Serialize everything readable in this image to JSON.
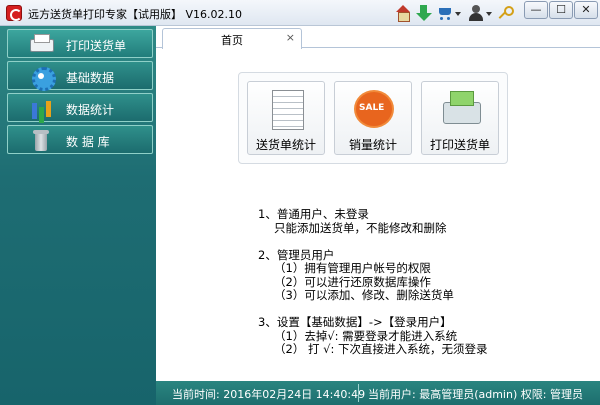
{
  "window": {
    "title": "远方送货单打印专家【试用版】 V16.02.10",
    "buttons": {
      "minimize": "—",
      "maximize": "☐",
      "close": "✕"
    }
  },
  "toolbar_icons": [
    "home-icon",
    "download-icon",
    "cart-icon",
    "user-icon",
    "key-icon"
  ],
  "sidebar": {
    "items": [
      {
        "label": "打印送货单",
        "icon": "printer-icon"
      },
      {
        "label": "基础数据",
        "icon": "gear-icon"
      },
      {
        "label": "数据统计",
        "icon": "bar-chart-icon"
      },
      {
        "label": "数 据 库",
        "icon": "trash-icon"
      }
    ]
  },
  "tabs": [
    {
      "label": "首页",
      "close": "×"
    }
  ],
  "tiles": [
    {
      "label": "送货单统计",
      "icon": "document-icon"
    },
    {
      "label": "销量统计",
      "icon": "sale-icon",
      "badge": "SALE"
    },
    {
      "label": "打印送货单",
      "icon": "printer-icon"
    }
  ],
  "instructions": {
    "s1_title": "1、普通用户、未登录",
    "s1_line1": "只能添加送货单，不能修改和删除",
    "s2_title": "2、管理员用户",
    "s2_line1": "（1）拥有管理用户帐号的权限",
    "s2_line2": "（2）可以进行还原数据库操作",
    "s2_line3": "（3）可以添加、修改、删除送货单",
    "s3_title": "3、设置【基础数据】->【登录用户】",
    "s3_line1": "（1）去掉√: 需要登录才能进入系统",
    "s3_line2": "（2） 打 √: 下次直接进入系统，无须登录"
  },
  "status": {
    "time": "当前时间: 2016年02月24日 14:40:49",
    "user": "当前用户: 最高管理员(admin)  权限: 管理员"
  },
  "colors": {
    "sidebar": "#1e6d73",
    "statusbar": "#2a8580",
    "accent": "#8fd0c8"
  }
}
